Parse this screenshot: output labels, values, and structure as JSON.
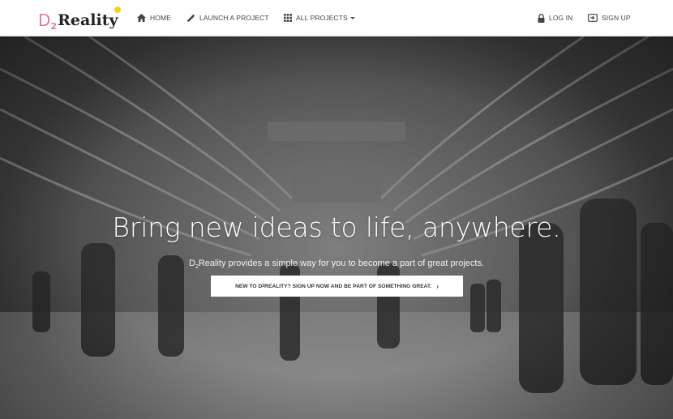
{
  "logo": {
    "prefix": "D",
    "subscript": "2",
    "word": "Reality"
  },
  "nav": {
    "home": "HOME",
    "launch": "LAUNCH A PROJECT",
    "projects": "ALL PROJECTS",
    "login": "LOG IN",
    "signup": "SIGN UP"
  },
  "hero": {
    "headline": "Bring new ideas to life, anywhere.",
    "tagline_prefix": "D",
    "tagline_sub": "2",
    "tagline_rest": "Reality provides a simple way for you to become a part of great projects.",
    "cta_prefix": "NEW TO D",
    "cta_sub": "2",
    "cta_rest": "REALITY? SIGN UP NOW AND BE PART OF SOMETHING GREAT.",
    "cta_chevron": "›"
  },
  "colors": {
    "logo_accent": "#e77aa0",
    "logo_star": "#f5d020",
    "nav_text": "#444444",
    "hero_overlay": "#5e5e5e"
  },
  "icons": {
    "home": "home-icon",
    "launch": "pencil-icon",
    "projects": "grid-icon",
    "login": "lock-icon",
    "signup": "sign-in-icon",
    "cta": "chevron-right-icon"
  }
}
